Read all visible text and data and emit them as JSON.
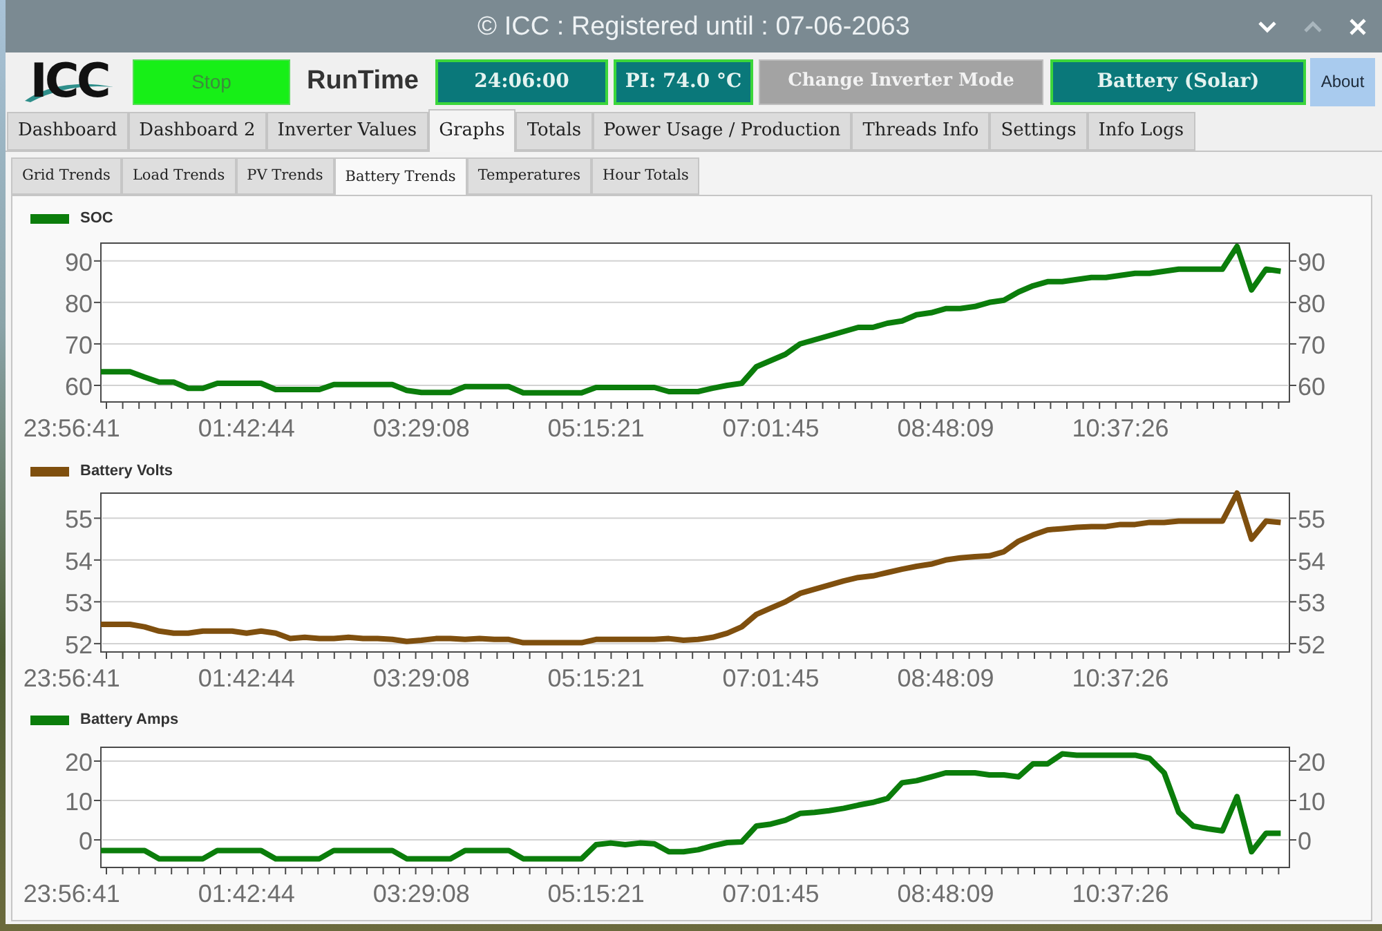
{
  "window": {
    "title": "© ICC : Registered until : 07-06-2063"
  },
  "toolbar": {
    "logo": "ICC",
    "stop_button": "Stop",
    "runtime_label": "RunTime",
    "runtime_value": "24:06:00",
    "pi_temperature": "PI: 74.0 °C",
    "change_mode_button": "Change Inverter Mode",
    "inverter_mode": "Battery (Solar)",
    "about_button": "About"
  },
  "tabs": [
    {
      "label": "Dashboard",
      "selected": false
    },
    {
      "label": "Dashboard 2",
      "selected": false
    },
    {
      "label": "Inverter Values",
      "selected": false
    },
    {
      "label": "Graphs",
      "selected": true
    },
    {
      "label": "Totals",
      "selected": false
    },
    {
      "label": "Power Usage / Production",
      "selected": false
    },
    {
      "label": "Threads Info",
      "selected": false
    },
    {
      "label": "Settings",
      "selected": false
    },
    {
      "label": "Info Logs",
      "selected": false
    }
  ],
  "subtabs": [
    {
      "label": "Grid Trends",
      "selected": false
    },
    {
      "label": "Load Trends",
      "selected": false
    },
    {
      "label": "PV Trends",
      "selected": false
    },
    {
      "label": "Battery Trends",
      "selected": true
    },
    {
      "label": "Temperatures",
      "selected": false
    },
    {
      "label": "Hour Totals",
      "selected": false
    }
  ],
  "charts": [
    {
      "left_axis_labels": [
        "90",
        "80",
        "70",
        "60"
      ],
      "right_axis_labels": [
        "90",
        "80",
        "70",
        "60"
      ],
      "chart_data": {
        "type": "line",
        "categories": [
          "23:56:41",
          null,
          null,
          null,
          null,
          null,
          null,
          null,
          null,
          null,
          null,
          null,
          "01:42:44",
          null,
          null,
          null,
          null,
          null,
          null,
          null,
          null,
          null,
          null,
          null,
          "03:29:08",
          null,
          null,
          null,
          null,
          null,
          null,
          null,
          null,
          null,
          null,
          null,
          "05:15:21",
          null,
          null,
          null,
          null,
          null,
          null,
          null,
          null,
          null,
          null,
          null,
          "07:01:45",
          null,
          null,
          null,
          null,
          null,
          null,
          null,
          null,
          null,
          null,
          null,
          "08:48:09",
          null,
          null,
          null,
          null,
          null,
          null,
          null,
          null,
          null,
          null,
          null,
          "10:37:26",
          null,
          null,
          null,
          null,
          null,
          null,
          null,
          null,
          null,
          null,
          null
        ],
        "series": [
          {
            "name": "SOC",
            "color": "#0b7d0b",
            "values": [
              null,
              null,
              63.3,
              63.3,
              63.3,
              62,
              60.8,
              60.8,
              59.3,
              59.3,
              60.5,
              60.5,
              60.5,
              60.5,
              59,
              59,
              59,
              59,
              60.2,
              60.2,
              60.2,
              60.2,
              60.2,
              58.8,
              58.3,
              58.3,
              58.3,
              59.7,
              59.7,
              59.7,
              59.7,
              58.2,
              58.2,
              58.2,
              58.2,
              58.2,
              59.5,
              59.5,
              59.5,
              59.5,
              59.5,
              58.5,
              58.5,
              58.5,
              59.3,
              60,
              60.5,
              64.5,
              66,
              67.5,
              70,
              71,
              72,
              73,
              74,
              74,
              75,
              75.5,
              77,
              77.5,
              78.5,
              78.5,
              79,
              80,
              80.5,
              82.5,
              84,
              85,
              85,
              85.5,
              86,
              86,
              86.5,
              87,
              87,
              87.5,
              88,
              88,
              88,
              88,
              93.5,
              83,
              88,
              87.5
            ]
          }
        ],
        "ylim": [
          56,
          94.3
        ],
        "yticks": [
          60,
          70,
          80,
          90
        ],
        "grid": true
      }
    },
    {
      "left_axis_labels": [
        "55",
        "54",
        "53",
        "52"
      ],
      "right_axis_labels": [
        "55",
        "54",
        "53",
        "52"
      ],
      "chart_data": {
        "type": "line",
        "categories": [
          "23:56:41",
          null,
          null,
          null,
          null,
          null,
          null,
          null,
          null,
          null,
          null,
          null,
          "01:42:44",
          null,
          null,
          null,
          null,
          null,
          null,
          null,
          null,
          null,
          null,
          null,
          "03:29:08",
          null,
          null,
          null,
          null,
          null,
          null,
          null,
          null,
          null,
          null,
          null,
          "05:15:21",
          null,
          null,
          null,
          null,
          null,
          null,
          null,
          null,
          null,
          null,
          null,
          "07:01:45",
          null,
          null,
          null,
          null,
          null,
          null,
          null,
          null,
          null,
          null,
          null,
          "08:48:09",
          null,
          null,
          null,
          null,
          null,
          null,
          null,
          null,
          null,
          null,
          null,
          "10:37:26",
          null,
          null,
          null,
          null,
          null,
          null,
          null,
          null,
          null,
          null,
          null
        ],
        "series": [
          {
            "name": "Battery Volts",
            "color": "#7f4f0e",
            "values": [
              null,
              null,
              52.46,
              52.46,
              52.46,
              52.4,
              52.3,
              52.25,
              52.25,
              52.3,
              52.3,
              52.3,
              52.25,
              52.3,
              52.25,
              52.12,
              52.15,
              52.12,
              52.12,
              52.15,
              52.12,
              52.12,
              52.1,
              52.05,
              52.08,
              52.12,
              52.12,
              52.1,
              52.12,
              52.1,
              52.1,
              52.02,
              52.02,
              52.02,
              52.02,
              52.02,
              52.1,
              52.1,
              52.1,
              52.1,
              52.1,
              52.12,
              52.08,
              52.1,
              52.15,
              52.25,
              52.4,
              52.7,
              52.85,
              53.0,
              53.2,
              53.3,
              53.4,
              53.5,
              53.58,
              53.62,
              53.7,
              53.78,
              53.85,
              53.9,
              54.0,
              54.05,
              54.08,
              54.1,
              54.2,
              54.45,
              54.6,
              54.72,
              54.75,
              54.78,
              54.8,
              54.8,
              54.85,
              54.85,
              54.9,
              54.9,
              54.93,
              54.93,
              54.93,
              54.93,
              55.6,
              54.5,
              54.93,
              54.9
            ]
          }
        ],
        "ylim": [
          51.8,
          55.6
        ],
        "yticks": [
          52,
          53,
          54,
          55
        ],
        "grid": true
      }
    },
    {
      "left_axis_labels": [
        "20",
        "10",
        "0"
      ],
      "right_axis_labels": [
        "20",
        "10",
        "0"
      ],
      "chart_data": {
        "type": "line",
        "categories": [
          "23:56:41",
          null,
          null,
          null,
          null,
          null,
          null,
          null,
          null,
          null,
          null,
          null,
          "01:42:44",
          null,
          null,
          null,
          null,
          null,
          null,
          null,
          null,
          null,
          null,
          null,
          "03:29:08",
          null,
          null,
          null,
          null,
          null,
          null,
          null,
          null,
          null,
          null,
          null,
          "05:15:21",
          null,
          null,
          null,
          null,
          null,
          null,
          null,
          null,
          null,
          null,
          null,
          "07:01:45",
          null,
          null,
          null,
          null,
          null,
          null,
          null,
          null,
          null,
          null,
          null,
          "08:48:09",
          null,
          null,
          null,
          null,
          null,
          null,
          null,
          null,
          null,
          null,
          null,
          "10:37:26",
          null,
          null,
          null,
          null,
          null,
          null,
          null,
          null,
          null,
          null,
          null
        ],
        "series": [
          {
            "name": "Battery Amps",
            "color": "#0b7d0b",
            "values": [
              null,
              null,
              -2.7,
              -2.7,
              -2.7,
              -2.7,
              -4.8,
              -4.8,
              -4.8,
              -4.8,
              -2.7,
              -2.7,
              -2.7,
              -2.7,
              -4.8,
              -4.8,
              -4.8,
              -4.8,
              -2.7,
              -2.7,
              -2.7,
              -2.7,
              -2.7,
              -4.8,
              -4.8,
              -4.8,
              -4.8,
              -2.7,
              -2.7,
              -2.7,
              -2.7,
              -4.8,
              -4.8,
              -4.8,
              -4.8,
              -4.8,
              -1.2,
              -0.8,
              -1.2,
              -0.8,
              -1,
              -3,
              -3,
              -2.5,
              -1.5,
              -0.7,
              -0.5,
              3.5,
              4,
              5,
              6.7,
              7,
              7.4,
              8,
              8.8,
              9.5,
              10.5,
              14.5,
              15,
              16,
              17,
              17,
              17,
              16.5,
              16.5,
              16,
              19.3,
              19.3,
              21.8,
              21.5,
              21.5,
              21.5,
              21.5,
              21.5,
              20.7,
              17,
              7,
              3.5,
              2.8,
              2.3,
              11,
              -3,
              1.7,
              1.7
            ]
          }
        ],
        "ylim": [
          -7,
          23.5
        ],
        "yticks": [
          0,
          10,
          20
        ],
        "grid": true
      }
    }
  ]
}
